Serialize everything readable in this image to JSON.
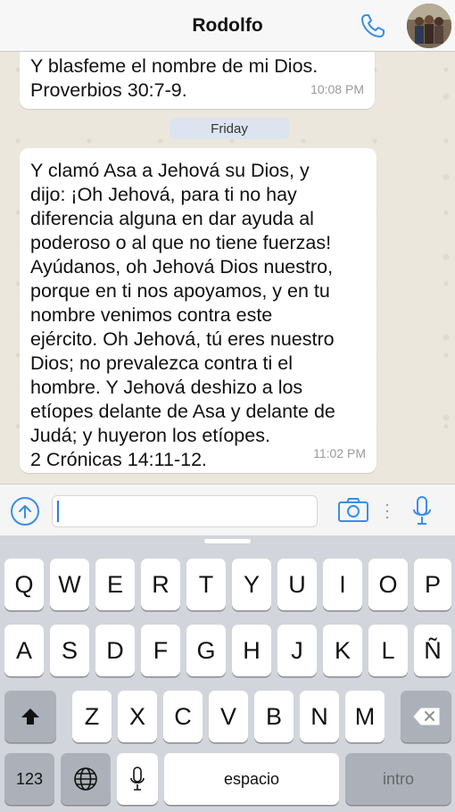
{
  "header": {
    "title": "Rodolfo"
  },
  "chat": {
    "day_separator": "Friday",
    "messages": [
      {
        "lines": [
          "Y blasfeme el nombre de mi Dios.",
          "Proverbios 30:7-9."
        ],
        "time": "10:08 PM"
      },
      {
        "lines": [
          "Y clamó Asa a Jehová su Dios, y",
          "dijo: ¡Oh Jehová, para ti no hay",
          "diferencia alguna en dar ayuda al",
          "poderoso o al que no tiene fuerzas!",
          "Ayúdanos, oh Jehová Dios nuestro,",
          "porque en ti nos apoyamos, y en tu",
          "nombre venimos contra este",
          "ejército. Oh Jehová, tú eres nuestro",
          "Dios; no prevalezca contra ti el",
          "hombre. Y Jehová deshizo a los",
          "etíopes delante de Asa y delante de",
          "Judá; y huyeron los etíopes.",
          "2 Crónicas 14:11-12."
        ],
        "time": "11:02 PM"
      }
    ]
  },
  "input": {
    "value": ""
  },
  "keyboard": {
    "row1": [
      "Q",
      "W",
      "E",
      "R",
      "T",
      "Y",
      "U",
      "I",
      "O",
      "P"
    ],
    "row2": [
      "A",
      "S",
      "D",
      "F",
      "G",
      "H",
      "J",
      "K",
      "L",
      "Ñ"
    ],
    "row3": [
      "Z",
      "X",
      "C",
      "V",
      "B",
      "N",
      "M"
    ],
    "numbers_key": "123",
    "space_key": "espacio",
    "return_key": "intro"
  },
  "colors": {
    "accent": "#3a8ee6",
    "chat_background": "#ece7dd",
    "bubble": "#ffffff",
    "day_pill": "#dde4f0",
    "keyboard": "#d2d5db"
  }
}
